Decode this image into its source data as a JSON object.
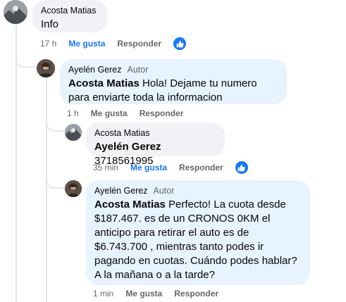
{
  "comments": [
    {
      "author": "Acosta Matias",
      "badge": "",
      "mention": "",
      "text": "Info",
      "time": "17 h",
      "like_label": "Me gusta",
      "reply_label": "Responder",
      "liked": true
    },
    {
      "author": "Ayelén Gerez",
      "badge": "Autor",
      "mention": "Acosta Matias",
      "text": " Hola! Dejame tu numero para enviarte toda la informacion",
      "time": "1 h",
      "like_label": "Me gusta",
      "reply_label": "Responder",
      "liked": false
    },
    {
      "author": "Acosta Matias",
      "badge": "",
      "mention": "Ayelén Gerez",
      "text": " 3718561995",
      "time": "35 min",
      "like_label": "Me gusta",
      "reply_label": "Responder",
      "liked": true
    },
    {
      "author": "Ayelén Gerez",
      "badge": "Autor",
      "mention": "Acosta Matias",
      "text": " Perfecto! La cuota desde $187.467. es de un CRONOS 0KM el anticipo para retirar el auto es de $6.743.700 , mientras tanto podes ir pagando en cuotas. Cuándo podes hablar? A la mañana o a la tarde?",
      "time": "1 min",
      "like_label": "Me gusta",
      "reply_label": "Responder",
      "liked": false
    }
  ],
  "colors": {
    "like_blue": "#1877f2",
    "bubble": "#f0f2f5",
    "author_bubble": "#e7f3ff"
  }
}
